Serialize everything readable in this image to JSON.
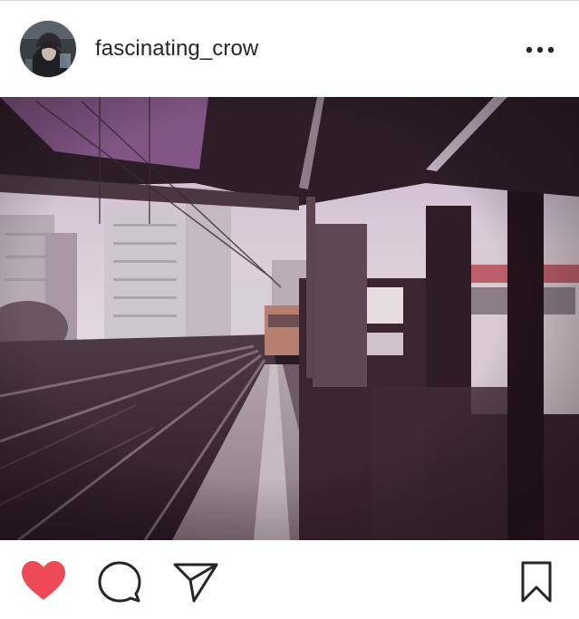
{
  "post": {
    "username": "fascinating_crow",
    "liked": true
  },
  "colors": {
    "like_active": "#ed4956",
    "icon_stroke": "#262626",
    "text": "#262626",
    "divider": "#dbdbdb"
  },
  "icons": {
    "more": "ellipsis-horizontal-icon",
    "like": "heart-filled-icon",
    "comment": "speech-bubble-icon",
    "share": "paper-plane-icon",
    "save": "bookmark-icon"
  }
}
